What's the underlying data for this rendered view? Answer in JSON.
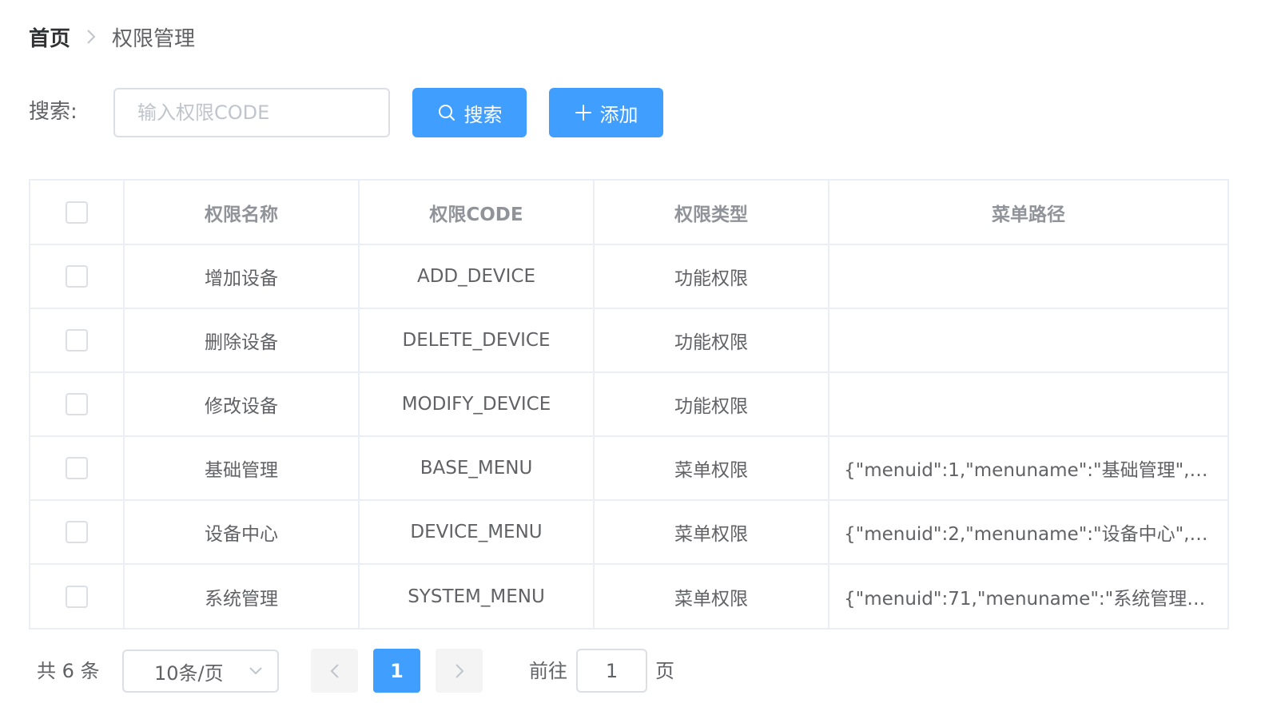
{
  "breadcrumb": {
    "home": "首页",
    "current": "权限管理"
  },
  "search": {
    "label": "搜索:",
    "placeholder": "输入权限CODE",
    "value": "",
    "search_button": "搜索",
    "add_button": "添加"
  },
  "table": {
    "headers": [
      "权限名称",
      "权限CODE",
      "权限类型",
      "菜单路径"
    ],
    "rows": [
      {
        "name": "增加设备",
        "code": "ADD_DEVICE",
        "type": "功能权限",
        "menu_path": ""
      },
      {
        "name": "删除设备",
        "code": "DELETE_DEVICE",
        "type": "功能权限",
        "menu_path": ""
      },
      {
        "name": "修改设备",
        "code": "MODIFY_DEVICE",
        "type": "功能权限",
        "menu_path": ""
      },
      {
        "name": "基础管理",
        "code": "BASE_MENU",
        "type": "菜单权限",
        "menu_path": "{\"menuid\":1,\"menuname\":\"基础管理\",\"..."
      },
      {
        "name": "设备中心",
        "code": "DEVICE_MENU",
        "type": "菜单权限",
        "menu_path": "{\"menuid\":2,\"menuname\":\"设备中心\",\"..."
      },
      {
        "name": "系统管理",
        "code": "SYSTEM_MENU",
        "type": "菜单权限",
        "menu_path": "{\"menuid\":71,\"menuname\":\"系统管理\",..."
      }
    ]
  },
  "pagination": {
    "total_text": "共 6 条",
    "page_size": "10条/页",
    "current_page": "1",
    "goto_label": "前往",
    "goto_value": "1",
    "goto_suffix": "页"
  },
  "colors": {
    "primary": "#409eff",
    "border": "#ebeef5",
    "text": "#606266",
    "header_text": "#909399"
  },
  "icons": {
    "breadcrumb_separator": "chevron-right-icon",
    "search_button": "search-icon",
    "add_button": "plus-icon",
    "page_size": "chevron-down-icon",
    "prev": "chevron-left-icon",
    "next": "chevron-right-icon"
  }
}
